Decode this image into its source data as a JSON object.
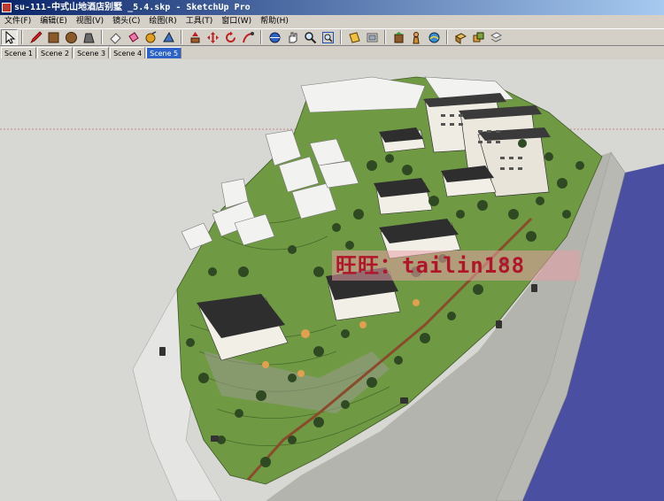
{
  "window": {
    "title": "su-111-中式山地酒店别墅 _5.4.skp - SketchUp Pro"
  },
  "menu": [
    "文件(F)",
    "编辑(E)",
    "视图(V)",
    "镜头(C)",
    "绘图(R)",
    "工具(T)",
    "窗口(W)",
    "帮助(H)"
  ],
  "toolbar": {
    "groups": [
      [
        "select-icon",
        "pencil-icon",
        "rectangle-icon",
        "circle-icon"
      ],
      [
        "eraser-icon",
        "paint-bucket-icon",
        "tape-measure-icon",
        "protractor-icon"
      ],
      [
        "push-pull-icon",
        "move-icon",
        "rotate-icon",
        "follow-me-icon"
      ],
      [
        "orbit-icon",
        "pan-icon",
        "zoom-icon",
        "zoom-extents-icon"
      ],
      [
        "section-plane-icon",
        "components-icon"
      ],
      [
        "add-location-icon",
        "position-camera-icon",
        "walk-icon"
      ],
      [
        "materials-icon",
        "styles-icon",
        "layers-icon"
      ]
    ]
  },
  "scenes": {
    "tabs": [
      "Scene 1",
      "Scene 2",
      "Scene 3",
      "Scene 4",
      "Scene 5"
    ],
    "selected": 4
  },
  "watermark": "旺旺：tailin188",
  "colors": {
    "sky": "#d7d7d3",
    "water": "#4a4fa2",
    "grass": "#6f9a43",
    "road": "#b4b4ae",
    "tree": "#2f4a22",
    "path": "#8a4b2c"
  }
}
